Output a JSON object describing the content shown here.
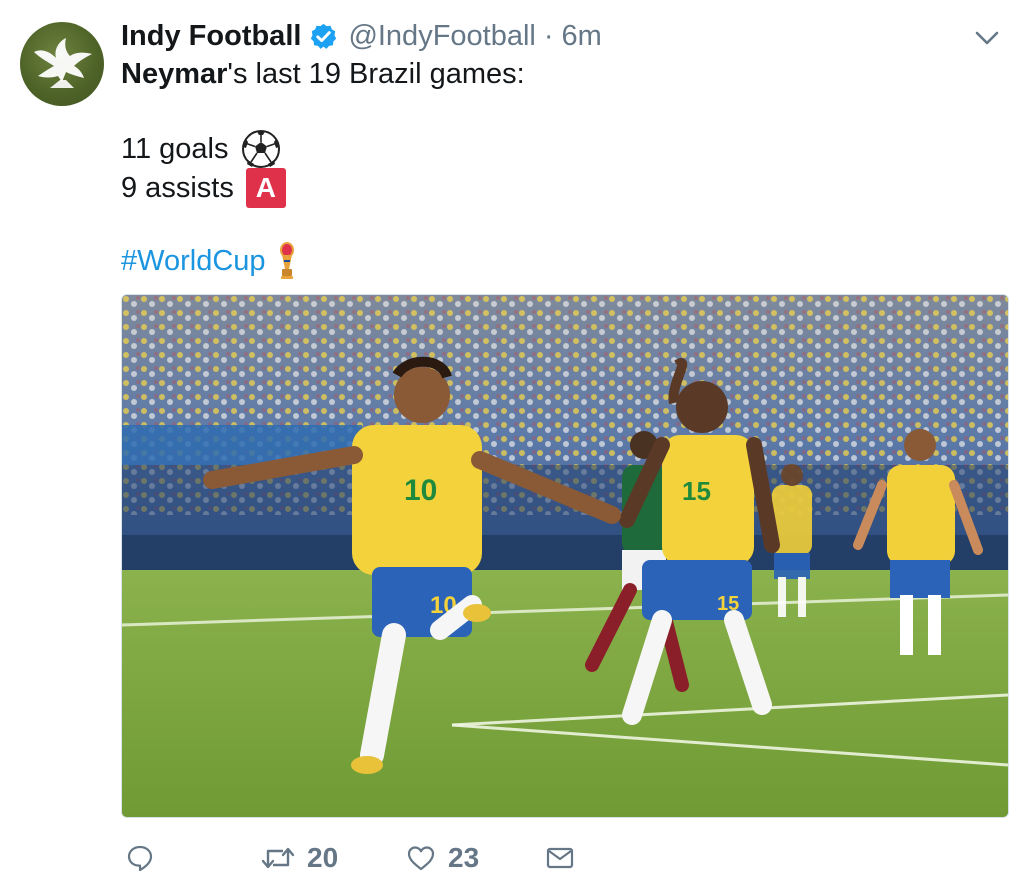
{
  "author": {
    "display_name": "Indy Football",
    "handle": "@IndyFootball",
    "separator": "·",
    "time": "6m",
    "verified": true,
    "avatar_icon": "eagle-logo-icon"
  },
  "tweet": {
    "name_bold": "Neymar",
    "line1_rest": "'s last 19 Brazil games:",
    "line2": "11 goals",
    "line2_emoji": "soccer-ball-icon",
    "line3": "9 assists",
    "line3_emoji": "A",
    "hashtag": "#WorldCup",
    "hashtag_emoji": "world-cup-trophy-icon"
  },
  "media": {
    "type": "photo",
    "description_icon": "football-celebration-photo"
  },
  "actions": {
    "reply_icon": "reply-icon",
    "retweet_icon": "retweet-icon",
    "retweet_count": "20",
    "like_icon": "heart-icon",
    "like_count": "23",
    "dm_icon": "envelope-icon"
  },
  "colors": {
    "link": "#1b95e0",
    "verified": "#1da1f2",
    "muted": "#657786",
    "assist_badge": "#e0314b"
  }
}
